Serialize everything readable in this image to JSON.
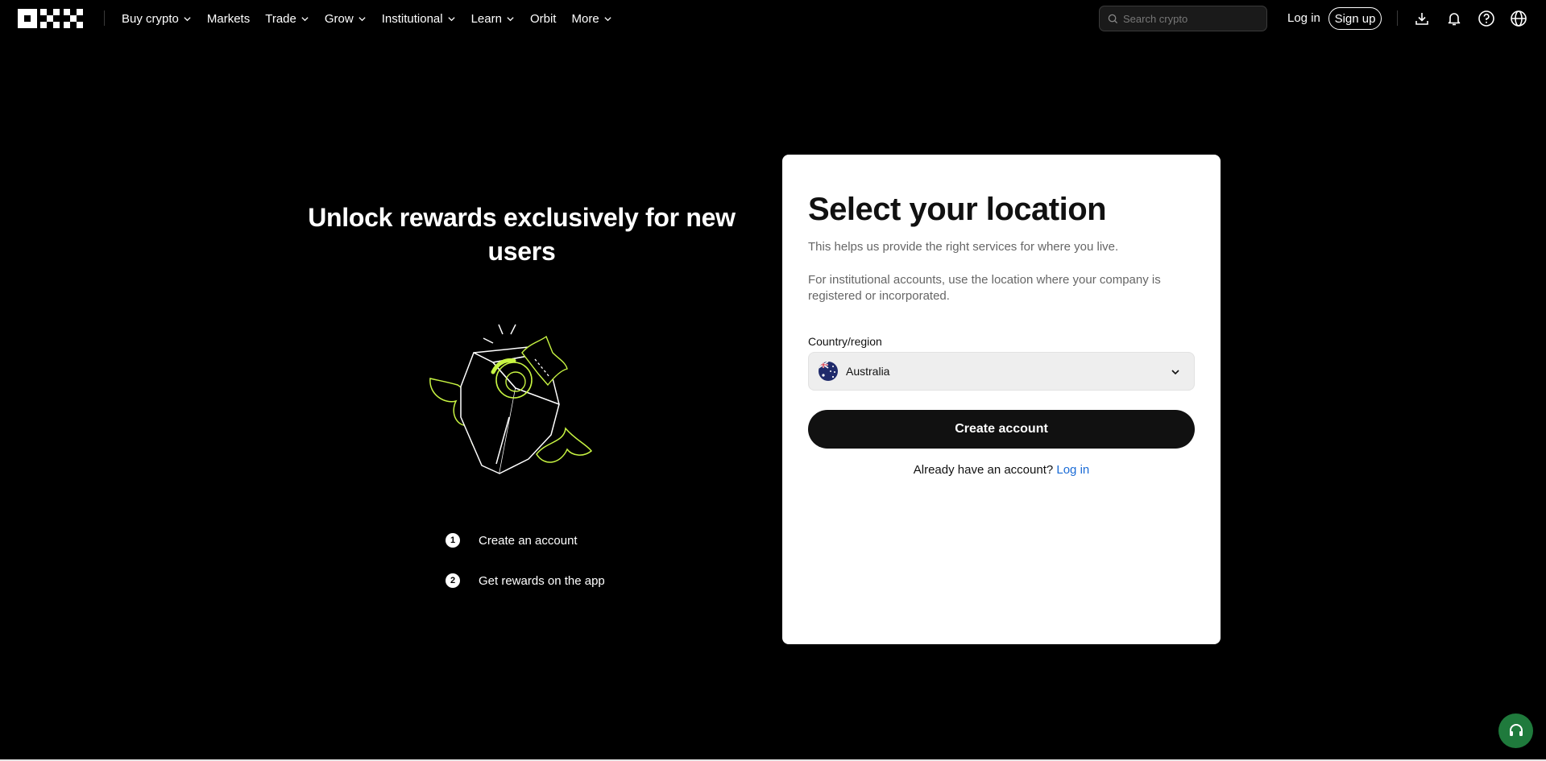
{
  "header": {
    "nav": [
      {
        "label": "Buy crypto",
        "has_dropdown": true
      },
      {
        "label": "Markets",
        "has_dropdown": false
      },
      {
        "label": "Trade",
        "has_dropdown": true
      },
      {
        "label": "Grow",
        "has_dropdown": true
      },
      {
        "label": "Institutional",
        "has_dropdown": true
      },
      {
        "label": "Learn",
        "has_dropdown": true
      },
      {
        "label": "Orbit",
        "has_dropdown": false
      },
      {
        "label": "More",
        "has_dropdown": true
      }
    ],
    "search_placeholder": "Search crypto",
    "login_label": "Log in",
    "signup_label": "Sign up",
    "icons": [
      "download-icon",
      "bell-icon",
      "help-icon",
      "globe-icon"
    ]
  },
  "promo": {
    "title_line1": "Unlock rewards exclusively for new",
    "title_line2": "users",
    "steps": [
      {
        "num": "1",
        "label": "Create an account"
      },
      {
        "num": "2",
        "label": "Get rewards on the app"
      }
    ]
  },
  "card": {
    "title": "Select your location",
    "subtitle": "This helps us provide the right services for where you live.",
    "note": "For institutional accounts, use the location where your company is registered or incorporated.",
    "field_label": "Country/region",
    "selected_country": "Australia",
    "create_button": "Create account",
    "already_text": "Already have an account?",
    "login_link": "Log in"
  },
  "colors": {
    "background": "#000000",
    "card": "#ffffff",
    "primary_button": "#111111",
    "link": "#1a6bd6",
    "accent_lime": "#c8f542",
    "support_button": "#1f7a3c"
  }
}
